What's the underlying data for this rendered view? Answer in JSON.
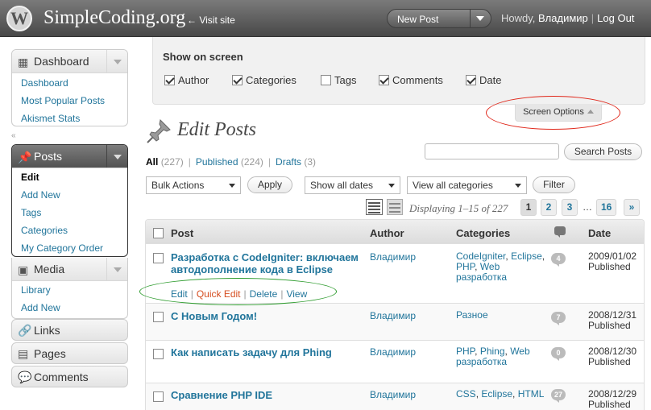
{
  "header": {
    "logo_glyph": "W",
    "site_name": "SimpleCoding.org",
    "visit_site": "← Visit site",
    "new_post": "New Post",
    "howdy_prefix": "Howdy, ",
    "user_name": "Владимир",
    "logout": "Log Out"
  },
  "sidebar": {
    "collapse_glyph": "«",
    "dashboard": {
      "title": "Dashboard",
      "items": [
        "Dashboard",
        "Most Popular Posts",
        "Akismet Stats"
      ]
    },
    "posts": {
      "title": "Posts",
      "items": [
        "Edit",
        "Add New",
        "Tags",
        "Categories",
        "My Category Order"
      ]
    },
    "media": {
      "title": "Media",
      "items": [
        "Library",
        "Add New"
      ]
    },
    "links": "Links",
    "pages": "Pages",
    "comments": "Comments"
  },
  "screen_options": {
    "title": "Show on screen",
    "columns": [
      {
        "label": "Author",
        "checked": true
      },
      {
        "label": "Categories",
        "checked": true
      },
      {
        "label": "Tags",
        "checked": false
      },
      {
        "label": "Comments",
        "checked": true
      },
      {
        "label": "Date",
        "checked": true
      }
    ],
    "toggle_label": "Screen Options"
  },
  "page": {
    "title": "Edit Posts",
    "filters": {
      "all": "All",
      "all_count": "(227)",
      "published": "Published",
      "published_count": "(224)",
      "drafts": "Drafts",
      "drafts_count": "(3)"
    },
    "search_button": "Search Posts",
    "bulk_actions": "Bulk Actions",
    "apply": "Apply",
    "dates": "Show all dates",
    "categories": "View all categories",
    "filter": "Filter",
    "displaying": "Displaying 1–15 of 227",
    "pages": [
      "1",
      "2",
      "3",
      "…",
      "16",
      "»"
    ],
    "current_page": "1"
  },
  "table": {
    "headers": {
      "post": "Post",
      "author": "Author",
      "categories": "Categories",
      "date": "Date"
    },
    "row_actions": {
      "edit": "Edit",
      "quick_edit": "Quick Edit",
      "delete": "Delete",
      "view": "View"
    },
    "rows": [
      {
        "title": "Разработка с CodeIgniter: включаем автодополнение кода в Eclipse",
        "author": "Владимир",
        "cats": [
          "CodeIgniter",
          "Eclipse",
          "PHP",
          "Web разработка"
        ],
        "comments": "4",
        "date": "2009/01/02",
        "status": "Published"
      },
      {
        "title": "С Новым Годом!",
        "author": "Владимир",
        "cats": [
          "Разное"
        ],
        "comments": "7",
        "date": "2008/12/31",
        "status": "Published"
      },
      {
        "title": "Как написать задачу для Phing",
        "author": "Владимир",
        "cats": [
          "PHP",
          "Phing",
          "Web разработка"
        ],
        "comments": "0",
        "date": "2008/12/30",
        "status": "Published"
      },
      {
        "title": "Сравнение PHP IDE",
        "author": "Владимир",
        "cats": [
          "CSS",
          "Eclipse",
          "HTML"
        ],
        "comments": "27",
        "date": "2008/12/29",
        "status": "Published"
      }
    ]
  },
  "colors": {
    "link": "#21759b",
    "quick_edit": "#d54e21",
    "annotation_red": "#e0271a",
    "annotation_green": "#2a9a2a"
  }
}
